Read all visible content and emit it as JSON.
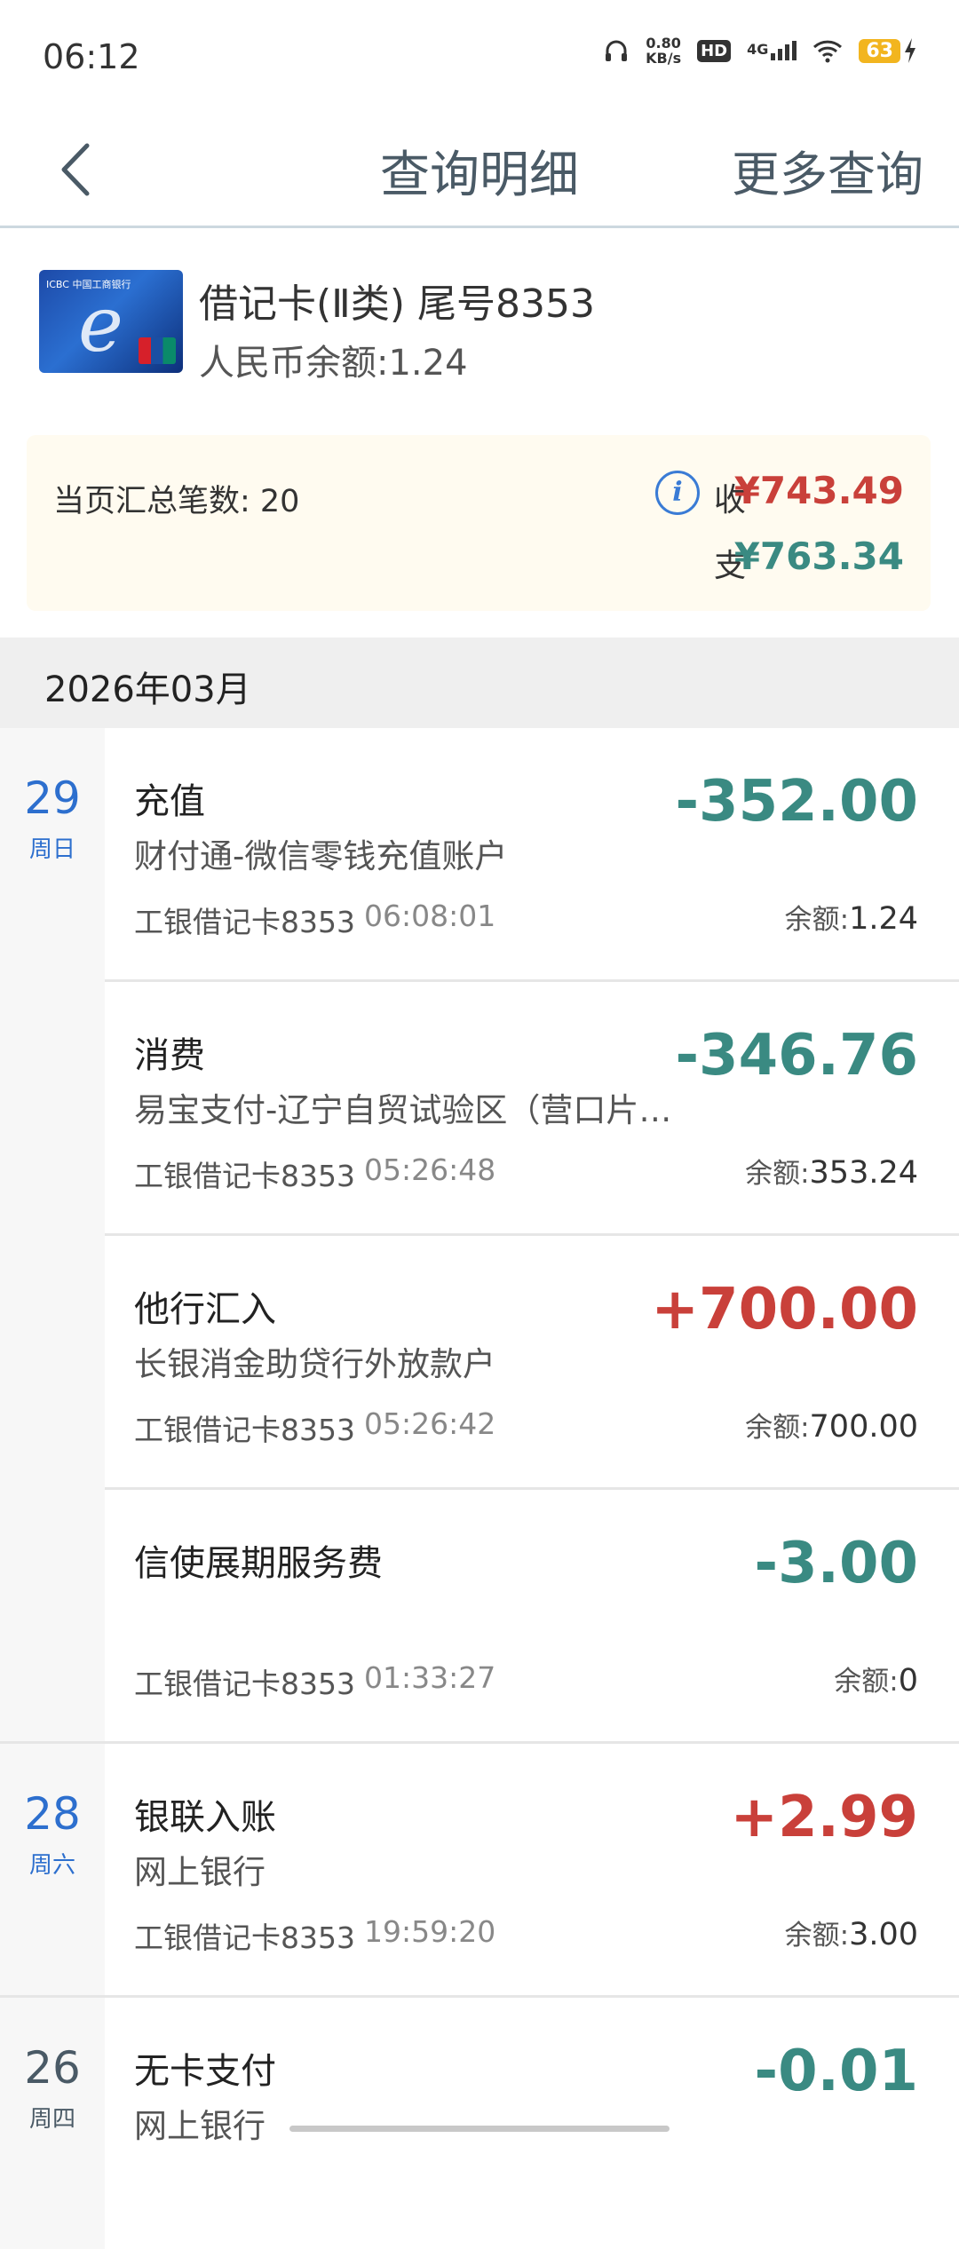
{
  "status": {
    "time": "06:12",
    "net_speed_value": "0.80",
    "net_speed_unit": "KB/s",
    "hd": "HD",
    "network": "4G",
    "battery": "63"
  },
  "header": {
    "title": "查询明细",
    "more": "更多查询"
  },
  "card": {
    "name": "借记卡(Ⅱ类) 尾号8353",
    "balance": "人民币余额:1.24",
    "logo_text": "ICBC 中国工商银行"
  },
  "summary": {
    "count": "当页汇总笔数: 20",
    "in_label": "收",
    "in_amount": "¥743.49",
    "out_label": "支",
    "out_amount": "¥763.34"
  },
  "month": "2026年03月",
  "groups": [
    {
      "day": "29",
      "weekday": "周日",
      "items": [
        {
          "title": "充值",
          "sub": "财付通-微信零钱充值账户",
          "card": "工银借记卡8353",
          "time": "06:08:01",
          "amount": "-352.00",
          "bal_label": "余额:",
          "bal": "1.24"
        },
        {
          "title": "消费",
          "sub": "易宝支付-辽宁自贸试验区（营口片…",
          "card": "工银借记卡8353",
          "time": "05:26:48",
          "amount": "-346.76",
          "bal_label": "余额:",
          "bal": "353.24"
        },
        {
          "title": "他行汇入",
          "sub": "长银消金助贷行外放款户",
          "card": "工银借记卡8353",
          "time": "05:26:42",
          "amount": "+700.00",
          "bal_label": "余额:",
          "bal": "700.00"
        },
        {
          "title": "信使展期服务费",
          "sub": "",
          "card": "工银借记卡8353",
          "time": "01:33:27",
          "amount": "-3.00",
          "bal_label": "余额:",
          "bal": "0"
        }
      ]
    },
    {
      "day": "28",
      "weekday": "周六",
      "items": [
        {
          "title": "银联入账",
          "sub": "网上银行",
          "card": "工银借记卡8353",
          "time": "19:59:20",
          "amount": "+2.99",
          "bal_label": "余额:",
          "bal": "3.00"
        }
      ]
    },
    {
      "day": "26",
      "weekday": "周四",
      "items": [
        {
          "title": "无卡支付",
          "sub": "网上银行",
          "card": "",
          "time": "",
          "amount": "-0.01",
          "bal_label": "",
          "bal": ""
        }
      ]
    }
  ]
}
